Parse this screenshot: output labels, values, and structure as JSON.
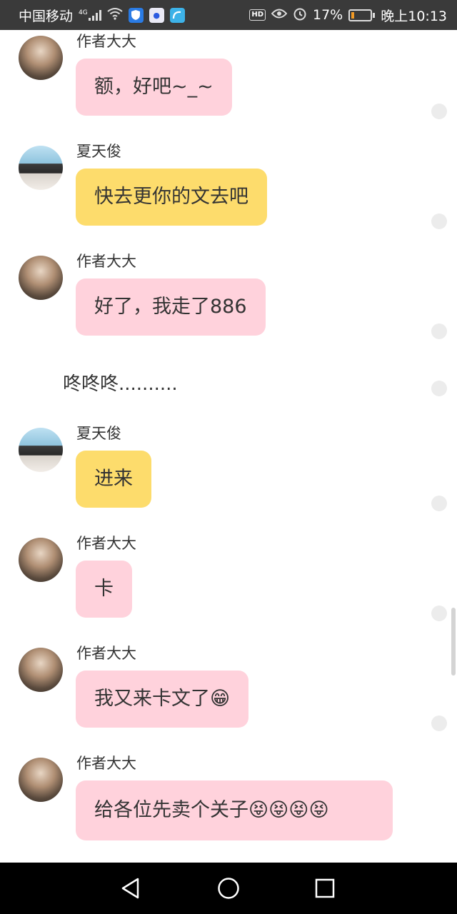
{
  "status_bar": {
    "carrier": "中国移动",
    "network": "4G",
    "hd": "HD",
    "battery_text": "17%",
    "battery_level": 0.17,
    "time": "晚上10:13",
    "icons": [
      "signal-icon",
      "wifi-icon",
      "shield-app-icon",
      "baidu-app-icon",
      "browser-app-icon",
      "eye-icon",
      "alarm-icon",
      "battery-icon"
    ]
  },
  "messages": [
    {
      "sender": "作者大大",
      "text": "额，好吧~_~",
      "style": "pink",
      "avatar": "author"
    },
    {
      "sender": "夏天俊",
      "text": "快去更你的文去吧",
      "style": "yellow",
      "avatar": "boy"
    },
    {
      "sender": "作者大大",
      "text": "好了，我走了886",
      "style": "pink",
      "avatar": "author"
    },
    {
      "sender": "夏天俊",
      "text": "进来",
      "style": "yellow",
      "avatar": "boy"
    },
    {
      "sender": "作者大大",
      "text": "卡",
      "style": "pink",
      "avatar": "author"
    },
    {
      "sender": "作者大大",
      "text": "我又来卡文了😁",
      "style": "pink",
      "avatar": "author"
    },
    {
      "sender": "作者大大",
      "text": "给各位先卖个关子😝😝😝😝",
      "style": "pink",
      "avatar": "author"
    }
  ],
  "narration": "咚咚咚..........",
  "colors": {
    "status_bg": "#3a3a3a",
    "pink_bubble": "#ffd2dc",
    "yellow_bubble": "#fddc6c",
    "battery": "#f29a25"
  },
  "nav": [
    "back-icon",
    "home-icon",
    "recents-icon"
  ]
}
